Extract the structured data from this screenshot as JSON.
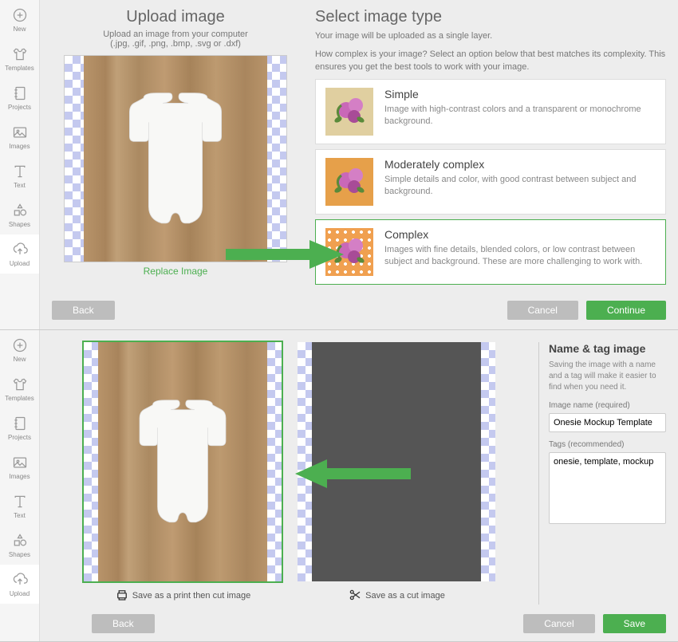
{
  "sidebar": {
    "items": [
      {
        "label": "New"
      },
      {
        "label": "Templates"
      },
      {
        "label": "Projects"
      },
      {
        "label": "Images"
      },
      {
        "label": "Text"
      },
      {
        "label": "Shapes"
      },
      {
        "label": "Upload"
      }
    ]
  },
  "upload_panel": {
    "title": "Upload image",
    "subtitle": "Upload an image from your computer",
    "formats": "(.jpg, .gif, .png, .bmp, .svg or .dxf)",
    "replace_label": "Replace Image"
  },
  "select_panel": {
    "title": "Select image type",
    "line1": "Your image will be uploaded as a single layer.",
    "line2": "How complex is your image? Select an option below that best matches its complexity. This ensures you get the best tools to work with your image.",
    "options": [
      {
        "title": "Simple",
        "desc": "Image with high-contrast colors and a transparent or monochrome background."
      },
      {
        "title": "Moderately complex",
        "desc": "Simple details and color, with good contrast between subject and background."
      },
      {
        "title": "Complex",
        "desc": "Images with fine details, blended colors, or low contrast between subject and background. These are more challenging to work with."
      }
    ]
  },
  "buttons": {
    "back": "Back",
    "cancel": "Cancel",
    "continue": "Continue",
    "save": "Save"
  },
  "save_screen": {
    "print_cut_label": "Save as a print then cut image",
    "cut_label": "Save as a cut image",
    "panel_title": "Name & tag image",
    "panel_hint": "Saving the image with a name and a tag will make it easier to find when you need it.",
    "name_label": "Image name (required)",
    "name_value": "Onesie Mockup Template",
    "tags_label": "Tags (recommended)",
    "tags_value": "onesie, template, mockup"
  }
}
